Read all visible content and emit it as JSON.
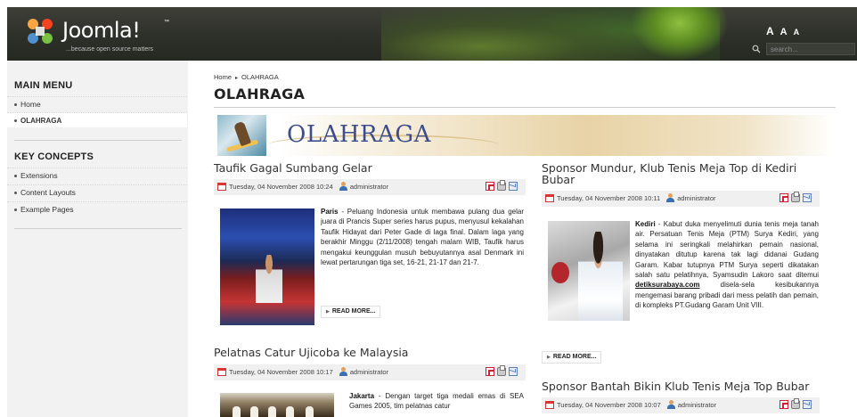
{
  "colors": {
    "header_bg": "#2d2f29",
    "sidebar_bg": "#f2f2f2",
    "banner_text": "#3d4d8c",
    "meta_bar": "#f0f0f0"
  },
  "header": {
    "logo_text": "Joomla!",
    "logo_tm": "™",
    "tagline": "...because open source matters",
    "font_sizes": {
      "large": "A",
      "medium": "A",
      "small": "A"
    },
    "search": {
      "placeholder": "search...",
      "icon": "search-icon"
    }
  },
  "sidebar": {
    "main_menu": {
      "title": "MAIN MENU",
      "items": [
        {
          "label": "Home"
        },
        {
          "label": "OLAHRAGA",
          "active": true
        }
      ]
    },
    "key_concepts": {
      "title": "KEY CONCEPTS",
      "items": [
        {
          "label": "Extensions"
        },
        {
          "label": "Content Layouts"
        },
        {
          "label": "Example Pages"
        }
      ]
    }
  },
  "main": {
    "breadcrumb": {
      "home": "Home",
      "separator": "▸",
      "current": "OLAHRAGA"
    },
    "page_title": "OLAHRAGA",
    "banner_text": "OLAHRAGA",
    "articles": [
      {
        "title": "Taufik Gagal Sumbang Gelar",
        "date": "Tuesday, 04 November 2008 10:24",
        "author": "administrator",
        "lead": "Paris",
        "body": " - Peluang Indonesia untuk membawa pulang dua gelar juara di Prancis Super series harus pupus, menyusul kekalahan Taufik Hidayat dari Peter Gade di laga final. Dalam laga yang berakhir Minggu (2/11/2008) tengah malam WIB, Taufik harus mengakui keunggulan musuh bebuyutannya asal Denmark ini lewat pertarungan tiga set, 16-21, 21-17 dan 21-7.",
        "readmore": "READ MORE..."
      },
      {
        "title": "Sponsor Mundur, Klub Tenis Meja Top di Kediri Bubar",
        "date": "Tuesday, 04 November 2008 10:11",
        "author": "administrator",
        "lead": "Kediri",
        "body_1": " - Kabut duka menyelimuti dunia tenis meja tanah air. Persatuan Tenis Meja (PTM) Surya Kediri, yang selama ini seringkali melahirkan pemain nasional, dinyatakan ditutup karena tak lagi didanai Gudang Garam. Kabar tutupnya PTM Surya seperti dikatakan salah satu pelatihnya, Syamsudin Lakoro saat ditemui ",
        "link": "detiksurabaya.com",
        "body_2": " disela-sela kesibukannya mengemasi barang pribadi dari mess pelatih dan pemain, di kompleks PT.Gudang Garam Unit VIII.",
        "readmore": "READ MORE..."
      },
      {
        "title": "Pelatnas Catur Ujicoba ke Malaysia",
        "date": "Tuesday, 04 November 2008 10:17",
        "author": "administrator",
        "lead": "Jakarta",
        "body": " - Dengan target tiga medali emas di SEA Games 2005, tim pelatnas catur"
      },
      {
        "title": "Sponsor Bantah Bikin Klub Tenis Meja Top Bubar",
        "date": "Tuesday, 04 November 2008 10:07",
        "author": "administrator"
      }
    ]
  }
}
